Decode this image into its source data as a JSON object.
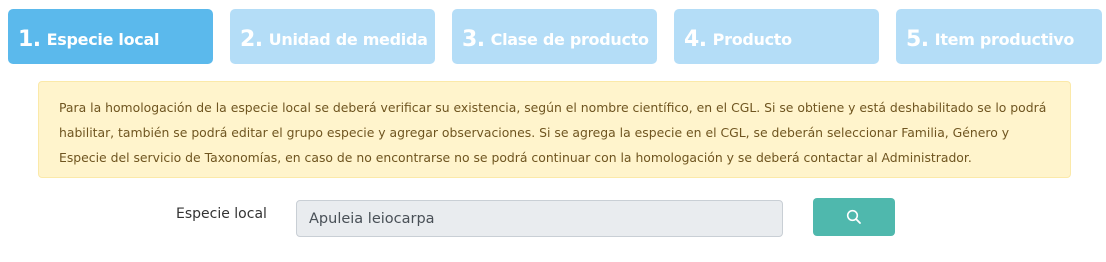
{
  "steps": [
    {
      "number": "1.",
      "label": "Especie local",
      "active": true
    },
    {
      "number": "2.",
      "label": "Unidad de medida",
      "active": false
    },
    {
      "number": "3.",
      "label": "Clase de producto",
      "active": false
    },
    {
      "number": "4.",
      "label": "Producto",
      "active": false
    },
    {
      "number": "5.",
      "label": "Item productivo",
      "active": false
    }
  ],
  "info": {
    "text": "Para la homologación de la especie local se deberá verificar su existencia, según el nombre científico, en el CGL. Si se obtiene y está deshabilitado se lo podrá habilitar, también se podrá editar el grupo especie y agregar observaciones. Si se agrega la especie en el CGL, se deberán seleccionar Familia, Género y Especie del servicio de Taxonomías, en caso de no encontrarse no se podrá continuar con la homologación y se deberá contactar al Administrador."
  },
  "form": {
    "especie_label": "Especie local",
    "especie_value": "Apuleia leiocarpa",
    "search_icon": "search-icon"
  },
  "colors": {
    "step_active": "#5bb9ec",
    "step_inactive": "#b4ddf7",
    "alert_bg": "#fff4cc",
    "alert_text": "#6f5520",
    "search_button": "#4fb8ad"
  }
}
